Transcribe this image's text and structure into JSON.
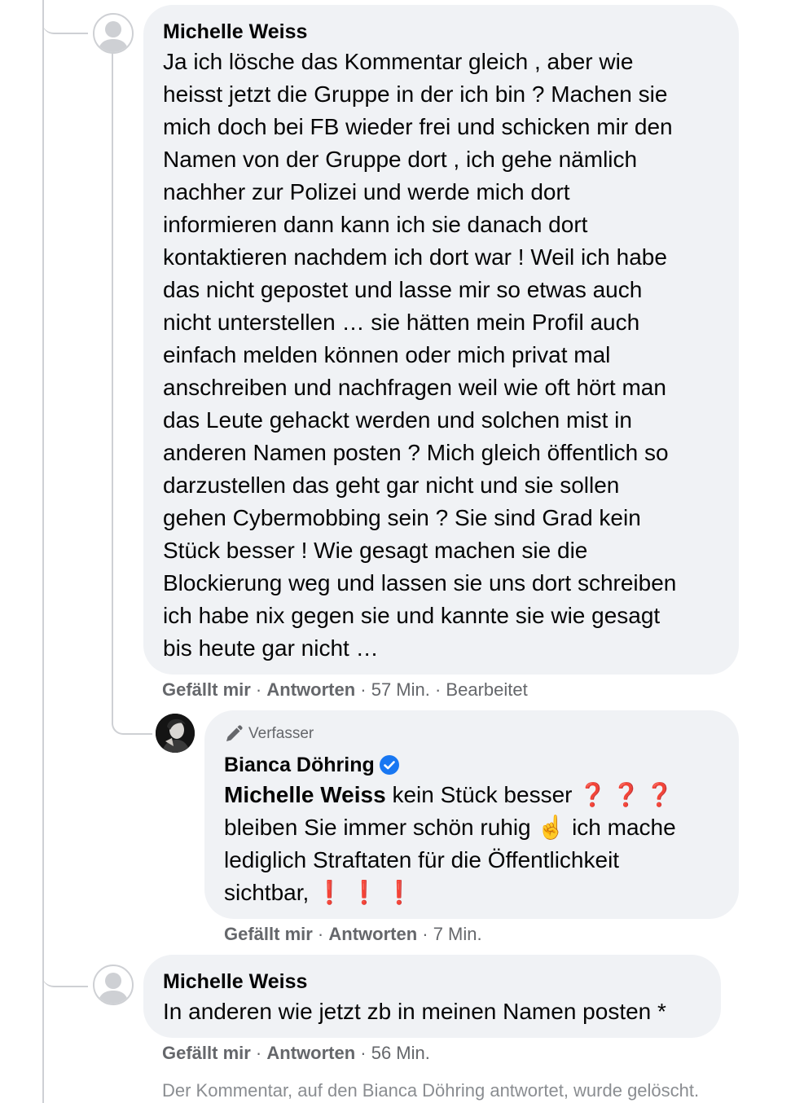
{
  "comments": [
    {
      "author": "Michelle Weiss",
      "text": "Ja ich lösche das Kommentar gleich , aber wie\nheisst jetzt die Gruppe in der ich bin ? Machen sie\nmich doch bei FB wieder frei und schicken mir den\nNamen von der Gruppe dort , ich gehe nämlich\nnachher zur Polizei und werde mich dort\ninformieren dann kann ich sie danach dort\nkontaktieren nachdem ich dort war ! Weil ich habe\ndas nicht gepostet und lasse mir so etwas auch\nnicht unterstellen … sie hätten mein Profil auch\neinfach melden können oder mich privat mal\nanschreiben und nachfragen weil wie oft hört man\ndas Leute gehackt werden und solchen mist in\nanderen Namen posten ? Mich gleich öffentlich so\ndarzustellen das geht gar nicht und sie sollen\ngehen Cybermobbing sein ? Sie sind Grad kein\nStück besser ! Wie gesagt machen sie die\nBlockierung weg und lassen sie uns dort schreiben\nich habe nix gegen sie und kannte sie wie gesagt\nbis heute gar nicht …",
      "like": "Gefällt mir",
      "reply": "Antworten",
      "time": "57 Min.",
      "edited": "Bearbeitet"
    },
    {
      "badge": "Verfasser",
      "author": "Bianca Döhring",
      "mention": "Michelle Weiss",
      "line1_rest": " kein Stück besser ",
      "line1_emoji": "❓❓❓",
      "line2a": "bleiben Sie immer schön ruhig ",
      "line2_emoji": "☝",
      "line2b": " ich mache",
      "line3": "lediglich Straftaten für die Öffentlichkeit",
      "line4": "sichtbar, ",
      "line4_emoji": "❗❗❗",
      "like": "Gefällt mir",
      "reply": "Antworten",
      "time": "7 Min."
    },
    {
      "author": "Michelle Weiss",
      "text": "In anderen wie jetzt zb in meinen Namen posten *",
      "like": "Gefällt mir",
      "reply": "Antworten",
      "time": "56 Min."
    }
  ],
  "sep": " · ",
  "deleted_notice": "Der Kommentar, auf den Bianca Döhring antwortet, wurde gelöscht.",
  "colors": {
    "bubble": "#f0f2f5",
    "meta": "#65676b",
    "verified": "#1877f2",
    "thread_line": "#ced0d4"
  }
}
